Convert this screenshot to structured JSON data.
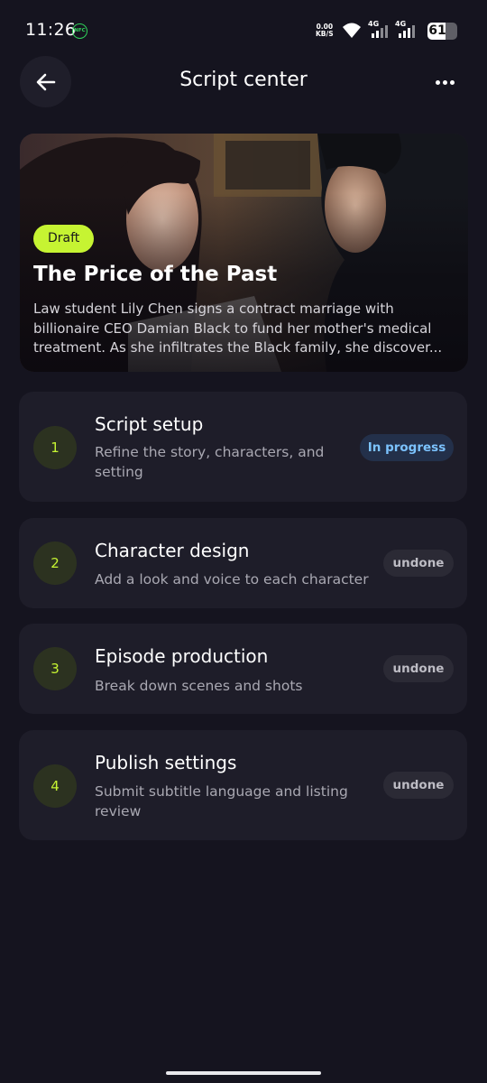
{
  "status_bar": {
    "time": "11:26",
    "nfc_label": "NFC",
    "net_speed_value": "0.00",
    "net_speed_unit": "KB/S",
    "signal1_label": "4G",
    "signal2_label": "4G",
    "battery_percent": 61,
    "battery_text": "61"
  },
  "header": {
    "title": "Script center"
  },
  "hero": {
    "badge": "Draft",
    "title": "The Price of the Past",
    "description": "Law student Lily Chen signs a contract marriage with billionaire CEO Damian Black to fund her mother's medical treatment. As she infiltrates the Black family, she discover..."
  },
  "steps": [
    {
      "number": "1",
      "title": "Script setup",
      "description": "Refine the story, characters, and setting",
      "status": "In progress"
    },
    {
      "number": "2",
      "title": "Character design",
      "description": "Add a look and voice to each character",
      "status": "undone"
    },
    {
      "number": "3",
      "title": "Episode production",
      "description": "Break down scenes and shots",
      "status": "undone"
    },
    {
      "number": "4",
      "title": "Publish settings",
      "description": "Submit subtitle language and listing review",
      "status": "undone"
    }
  ],
  "colors": {
    "accent": "#c6f432",
    "background": "#15141f",
    "card": "#1e1d29",
    "in_progress": "#7cc3ff"
  }
}
